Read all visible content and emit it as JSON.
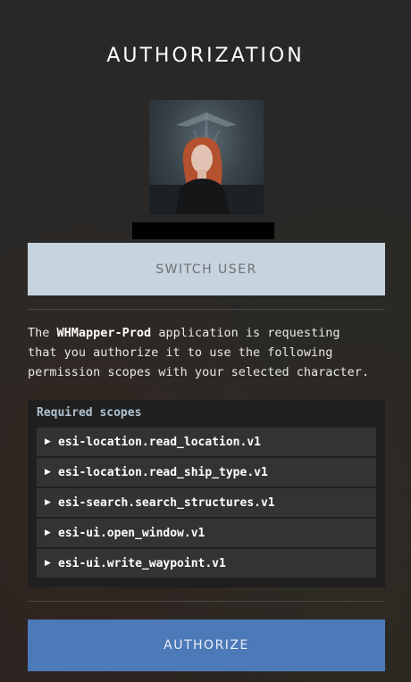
{
  "title": "AUTHORIZATION",
  "switch_user_label": "SWITCH USER",
  "description": {
    "line1_prefix": "The ",
    "app_name": "WHMapper-Prod",
    "line1_suffix": " application is requesting",
    "line2": "that you authorize it to use the following",
    "line3": "permission scopes with your selected character."
  },
  "scopes": {
    "heading": "Required scopes",
    "items": [
      {
        "label": "esi-location.read_location.v1"
      },
      {
        "label": "esi-location.read_ship_type.v1"
      },
      {
        "label": "esi-search.search_structures.v1"
      },
      {
        "label": "esi-ui.open_window.v1"
      },
      {
        "label": "esi-ui.write_waypoint.v1"
      }
    ]
  },
  "authorize_label": "AUTHORIZE",
  "colors": {
    "switch_button_bg": "#c7d3dd",
    "authorize_button_bg": "#4c79b8",
    "scopes_heading": "#b0c2d1"
  }
}
